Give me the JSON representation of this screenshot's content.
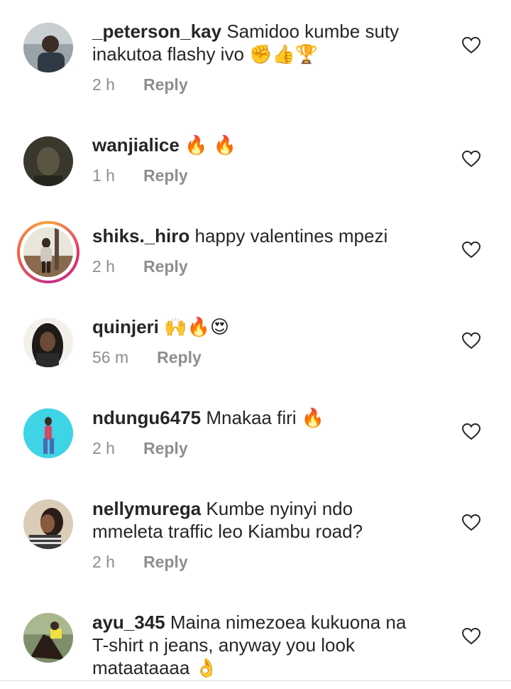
{
  "comments": [
    {
      "username": "_peterson_kay",
      "text": "Samidoo kumbe suty inakutoa flashy ivo",
      "emojis": "✊👍🏆",
      "time": "2 h",
      "reply": "Reply"
    },
    {
      "username": "wanjialice",
      "text": "",
      "emojis": "🔥 🔥",
      "time": "1 h",
      "reply": "Reply"
    },
    {
      "username": "shiks._hiro",
      "text": "happy valentines mpezi",
      "emojis": "",
      "time": "2 h",
      "reply": "Reply"
    },
    {
      "username": "quinjeri",
      "text": "",
      "emojis": "🙌🔥😍",
      "time": "56 m",
      "reply": "Reply"
    },
    {
      "username": "ndungu6475",
      "text": "Mnakaa firi",
      "emojis": "🔥",
      "time": "2 h",
      "reply": "Reply"
    },
    {
      "username": "nellymurega",
      "text": "Kumbe nyinyi ndo mmeleta traffic leo Kiambu road?",
      "emojis": "",
      "time": "2 h",
      "reply": "Reply"
    },
    {
      "username": "ayu_345",
      "text": "Maina nimezoea kukuona na T-shirt n jeans, anyway you look mataataaaa",
      "emojis": "👌",
      "time": "",
      "reply": ""
    }
  ],
  "colors": {
    "text": "#262626",
    "secondary": "#8e8e8e",
    "story_ring_start": "#f9a43b",
    "story_ring_end": "#c13584"
  }
}
